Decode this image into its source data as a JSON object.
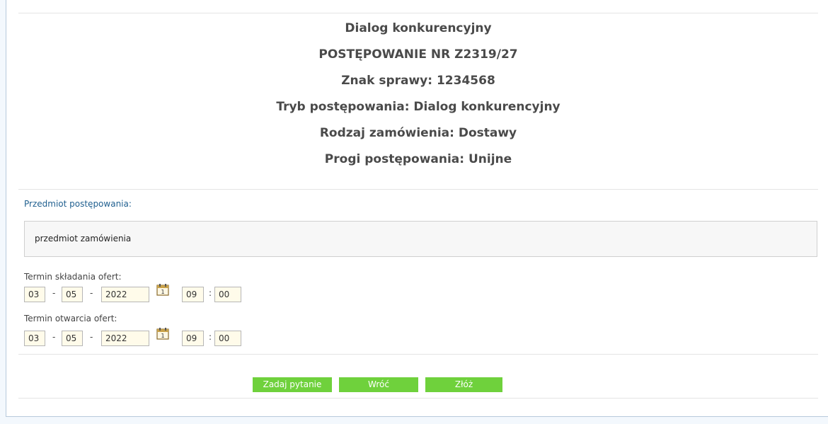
{
  "header": {
    "lines": [
      "Dialog konkurencyjny",
      "POSTĘPOWANIE NR Z2319/27",
      "Znak sprawy: 1234568",
      "Tryb postępowania: Dialog konkurencyjny",
      "Rodzaj zamówienia: Dostawy",
      "Progi postępowania: Unijne"
    ]
  },
  "subject": {
    "label": "Przedmiot postępowania:",
    "value": "przedmiot zamówienia"
  },
  "offer_deadline": {
    "label": "Termin składania ofert:",
    "day": "03",
    "month": "05",
    "year": "2022",
    "hour": "09",
    "minute": "00"
  },
  "opening_deadline": {
    "label": "Termin otwarcia ofert:",
    "day": "03",
    "month": "05",
    "year": "2022",
    "hour": "09",
    "minute": "00"
  },
  "separators": {
    "date": "-",
    "time": ":"
  },
  "icons": {
    "calendar": "calendar-icon"
  },
  "buttons": {
    "ask": "Zadaj pytanie",
    "back": "Wróć",
    "submit": "Złóż"
  },
  "colors": {
    "button": "#6fd13c",
    "label_blue": "#1f5f8f",
    "input_bg": "#fffbea"
  }
}
